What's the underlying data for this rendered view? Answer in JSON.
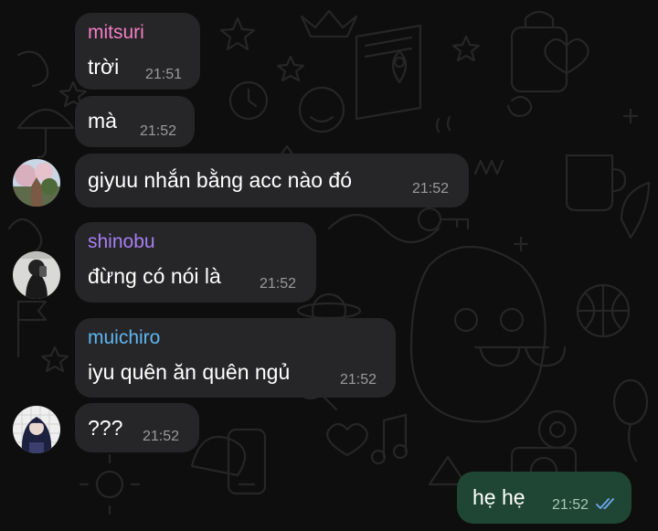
{
  "messages": [
    {
      "sender": "mitsuri",
      "sender_color": "#f27fc4",
      "text": "trời",
      "time": "21:51"
    },
    {
      "text": "mà",
      "time": "21:52"
    },
    {
      "text": "giyuu nhắn bằng acc nào đó",
      "time": "21:52"
    },
    {
      "sender": "shinobu",
      "sender_color": "#a77ff2",
      "text": "đừng có nói là",
      "time": "21:52"
    },
    {
      "sender": "muichiro",
      "sender_color": "#5fb6f2",
      "text": "iyu quên ăn quên ngủ",
      "time": "21:52"
    },
    {
      "text": "???",
      "time": "21:52"
    },
    {
      "text": "hẹ hẹ",
      "time": "21:52",
      "outgoing": true,
      "status_icon": "double-check-read-icon"
    }
  ],
  "colors": {
    "incoming_bubble": "#262628",
    "outgoing_bubble": "#1f4634",
    "read_check": "#6fa8f2"
  }
}
